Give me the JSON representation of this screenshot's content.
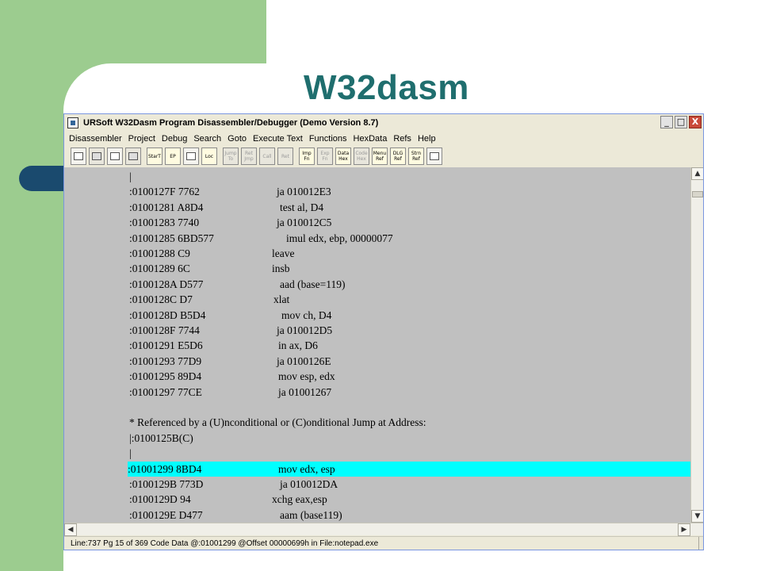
{
  "slide": {
    "title": "W32dasm"
  },
  "window": {
    "title": "URSoft W32Dasm Program Disassembler/Debugger (Demo Version 8.7)",
    "controls": {
      "minimize": "_",
      "maximize": "□",
      "close": "X"
    }
  },
  "menu": {
    "items": [
      "Disassembler",
      "Project",
      "Debug",
      "Search",
      "Goto",
      "Execute Text",
      "Functions",
      "HexData",
      "Refs",
      "Help"
    ]
  },
  "toolbar": {
    "buttons": [
      {
        "label": "",
        "icon": "open-file-icon",
        "enabled": true
      },
      {
        "label": "",
        "icon": "save-icon",
        "enabled": false
      },
      {
        "label": "",
        "icon": "font-brush-icon",
        "enabled": true
      },
      {
        "label": "",
        "icon": "print-setup-icon",
        "enabled": false
      },
      {
        "label": "StarT",
        "icon": "start-icon",
        "enabled": true
      },
      {
        "label": "EP",
        "icon": "entry-point-icon",
        "enabled": true
      },
      {
        "label": "",
        "icon": "goto-icon",
        "enabled": true
      },
      {
        "label": "Loc",
        "icon": "code-location-icon",
        "enabled": true
      },
      {
        "label": "Jump To",
        "icon": "jump-to-icon",
        "enabled": false
      },
      {
        "label": "Ret Jmp",
        "icon": "return-jump-icon",
        "enabled": false
      },
      {
        "label": "Call",
        "icon": "call-icon",
        "enabled": false
      },
      {
        "label": "Ret",
        "icon": "return-call-icon",
        "enabled": false
      },
      {
        "label": "Imp Fn",
        "icon": "imports-icon",
        "enabled": true
      },
      {
        "label": "Exp Fn",
        "icon": "exports-icon",
        "enabled": false
      },
      {
        "label": "Data Hex",
        "icon": "data-hex-icon",
        "enabled": true
      },
      {
        "label": "Code Hex",
        "icon": "code-hex-icon",
        "enabled": false
      },
      {
        "label": "Menu Ref",
        "icon": "menu-ref-icon",
        "enabled": true
      },
      {
        "label": "DLG Ref",
        "icon": "dialog-ref-icon",
        "enabled": true
      },
      {
        "label": "Strn Ref",
        "icon": "string-ref-icon",
        "enabled": true
      },
      {
        "label": "",
        "icon": "printer-icon",
        "enabled": true
      }
    ]
  },
  "code": {
    "lines": [
      {
        "addr": "|",
        "instr": "",
        "indent": 0
      },
      {
        "addr": ":0100127F 7762",
        "instr": "ja 010012E3",
        "indent": 186
      },
      {
        "addr": ":01001281 A8D4",
        "instr": "test al, D4",
        "indent": 190
      },
      {
        "addr": ":01001283 7740",
        "instr": "ja 010012C5",
        "indent": 186
      },
      {
        "addr": ":01001285 6BD577",
        "instr": "imul edx, ebp, 00000077",
        "indent": 198
      },
      {
        "addr": ":01001288 C9",
        "instr": "leave",
        "indent": 180
      },
      {
        "addr": ":01001289 6C",
        "instr": "insb",
        "indent": 180
      },
      {
        "addr": ":0100128A D577",
        "instr": "aad (base=119)",
        "indent": 190
      },
      {
        "addr": ":0100128C D7",
        "instr": "xlat",
        "indent": 182
      },
      {
        "addr": ":0100128D B5D4",
        "instr": "mov ch, D4",
        "indent": 192
      },
      {
        "addr": ":0100128F 7744",
        "instr": "ja 010012D5",
        "indent": 186
      },
      {
        "addr": ":01001291 E5D6",
        "instr": "in ax, D6",
        "indent": 188
      },
      {
        "addr": ":01001293 77D9",
        "instr": "ja 0100126E",
        "indent": 186
      },
      {
        "addr": ":01001295 89D4",
        "instr": "mov esp, edx",
        "indent": 188
      },
      {
        "addr": ":01001297 77CE",
        "instr": "ja 01001267",
        "indent": 188
      },
      {
        "addr": "",
        "instr": "",
        "indent": 0
      },
      {
        "addr": "* Referenced by a (U)nconditional or (C)onditional Jump at Address:",
        "instr": "",
        "indent": 0
      },
      {
        "addr": "|:0100125B(C)",
        "instr": "",
        "indent": 0
      },
      {
        "addr": "|",
        "instr": "",
        "indent": 0
      },
      {
        "addr": ":01001299 8BD4",
        "instr": "mov edx, esp",
        "indent": 190,
        "highlight": true
      },
      {
        "addr": ":0100129B 773D",
        "instr": "ja 010012DA",
        "indent": 190
      },
      {
        "addr": ":0100129D 94",
        "instr": "xchg eax,esp",
        "indent": 180
      },
      {
        "addr": ":0100129E D477",
        "instr": "aam (base119)",
        "indent": 190
      }
    ]
  },
  "scroll": {
    "up": "▲",
    "down": "▼",
    "left": "◀",
    "right": "▶"
  },
  "status": {
    "text": "Line:737 Pg 15 of 369  Code Data @:01001299 @Offset 00000699h in File:notepad.exe"
  },
  "colors": {
    "slide_green": "#9ccc8f",
    "slide_title": "#1f6e6e",
    "code_bg": "#c0c0c0",
    "highlight": "#00ffff",
    "accent_pill": "#1a4a6e"
  }
}
